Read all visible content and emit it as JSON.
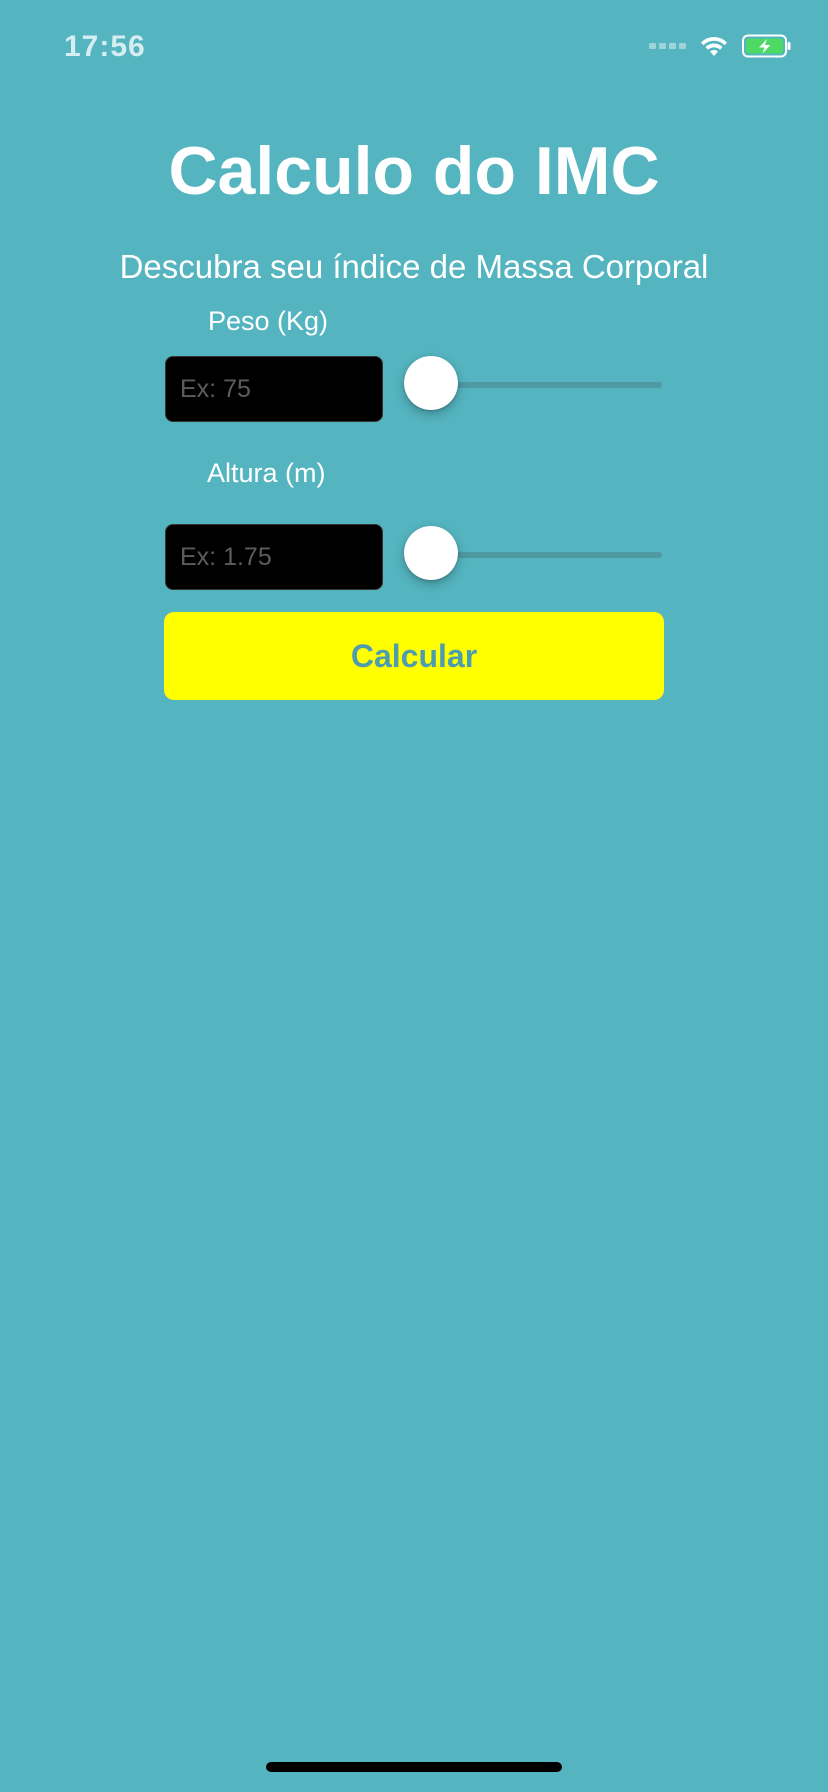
{
  "status_bar": {
    "time": "17:56",
    "icons": [
      "signal-icon",
      "wifi-icon",
      "battery-charging-icon"
    ]
  },
  "title": "Calculo do IMC",
  "subtitle": "Descubra seu índice de Massa Corporal",
  "weight": {
    "label": "Peso (Kg)",
    "placeholder": "Ex: 75",
    "slider_value": 0
  },
  "height": {
    "label": "Altura (m)",
    "placeholder": "Ex: 1.75",
    "slider_value": 0
  },
  "button": {
    "label": "Calcular"
  },
  "colors": {
    "background": "#54b4bf",
    "button_bg": "#ffff00",
    "button_text": "#4d9dae",
    "input_bg": "#000000",
    "battery": "#4cd964"
  }
}
